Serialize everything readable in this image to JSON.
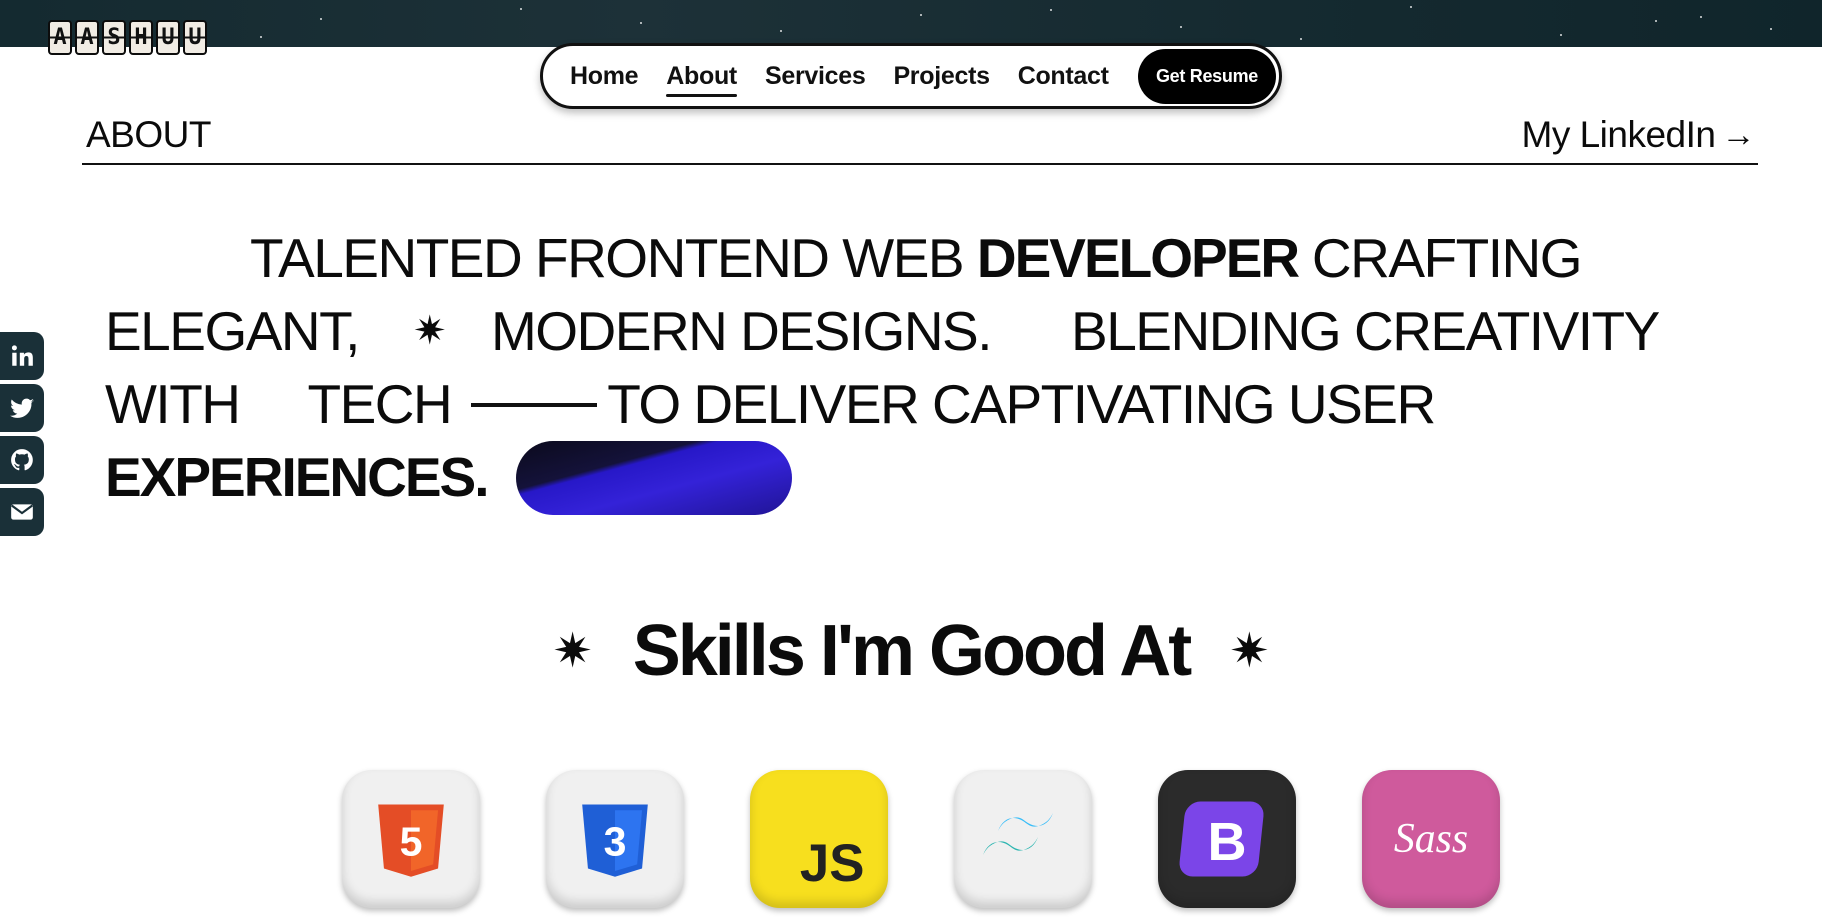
{
  "brand": {
    "logo_letters": [
      "A",
      "A",
      "S",
      "H",
      "U",
      "U"
    ]
  },
  "nav": {
    "items": [
      {
        "label": "Home",
        "active": false
      },
      {
        "label": "About",
        "active": true
      },
      {
        "label": "Services",
        "active": false
      },
      {
        "label": "Projects",
        "active": false
      },
      {
        "label": "Contact",
        "active": false
      }
    ],
    "resume_label": "Get Resume"
  },
  "about": {
    "section_title": "ABOUT",
    "linkedin_label": "My LinkedIn",
    "arrow_glyph": "→",
    "intro": {
      "l1_a": "TALENTED FRONTEND WEB ",
      "l1_b": "DEVELOPER",
      "l1_c": " CRAFTING",
      "l2_a": "ELEGANT,",
      "l2_b": "MODERN DESIGNS.",
      "l2_c": "BLENDING CREATIVITY",
      "l3_a": "WITH",
      "l3_b": "TECH",
      "l3_c": "TO DELIVER CAPTIVATING USER",
      "l4_a": "EXPERIENCES."
    },
    "sparkle_glyph": "✷"
  },
  "social": [
    {
      "icon": "linkedin-icon"
    },
    {
      "icon": "twitter-icon"
    },
    {
      "icon": "github-icon"
    },
    {
      "icon": "mail-icon"
    }
  ],
  "skills": {
    "heading": "Skills I'm Good At",
    "items": [
      {
        "icon": "html5-icon",
        "label": "5",
        "color": "#e44d26"
      },
      {
        "icon": "css3-icon",
        "label": "3",
        "color": "#1f5fd6"
      },
      {
        "icon": "javascript-icon",
        "label": "JS",
        "color": "#f7df1e"
      },
      {
        "icon": "tailwind-icon",
        "label": "",
        "color": "#38bdf8"
      },
      {
        "icon": "bootstrap-icon",
        "label": "B",
        "color": "#7b45e8"
      },
      {
        "icon": "sass-icon",
        "label": "Sass",
        "color": "#cc6699"
      }
    ]
  },
  "colors": {
    "top_band": "#1a2f35",
    "social_bg": "#1a3038",
    "text": "#0b0b0b",
    "accent_pill": "#2a1bd0"
  }
}
